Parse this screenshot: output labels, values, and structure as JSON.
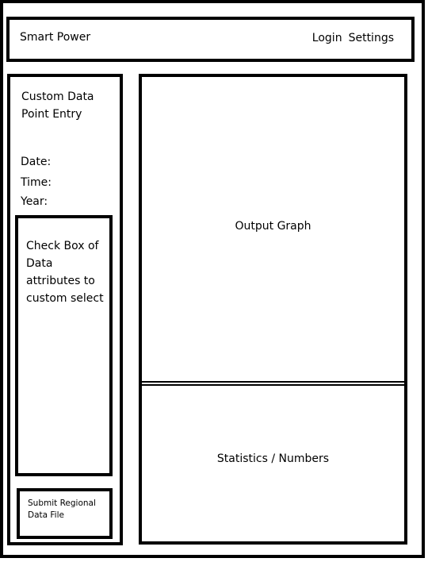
{
  "header": {
    "title": "Smart Power",
    "nav": {
      "login": "Login",
      "settings": "Settings"
    }
  },
  "sidebar": {
    "title": "Custom Data Point Entry",
    "fields": {
      "date": "Date:",
      "time": "Time:",
      "year": "Year:"
    },
    "checkbox_panel": "Check Box of Data attributes to custom select",
    "submit": "Submit Regional Data File"
  },
  "main": {
    "graph_label": "Output Graph",
    "stats_label": "Statistics / Numbers"
  }
}
